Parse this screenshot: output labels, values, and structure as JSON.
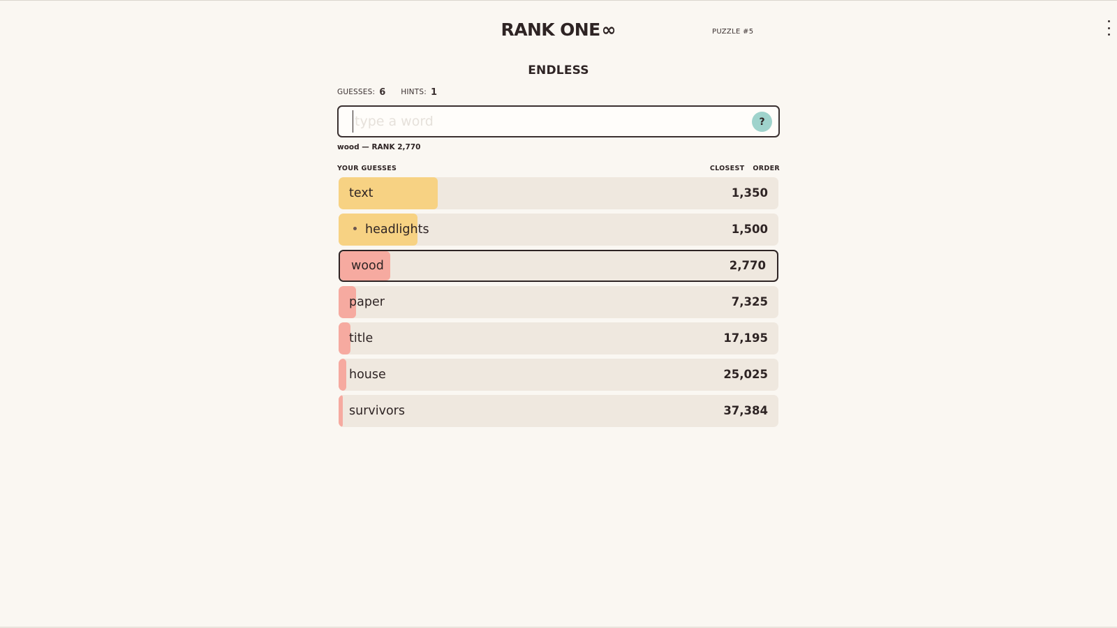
{
  "header": {
    "logo_text": "RANK ONE",
    "logo_symbol": "∞",
    "puzzle_label": "PUZZLE #5"
  },
  "mode": {
    "title": "ENDLESS"
  },
  "stats": {
    "guesses_label": "GUESSES:",
    "guesses_value": "6",
    "hints_label": "HINTS:",
    "hints_value": "1"
  },
  "input": {
    "placeholder": "type a word",
    "value": "",
    "help_label": "?"
  },
  "last_guess": {
    "text": "wood — RANK 2,770"
  },
  "list_header": {
    "title": "YOUR GUESSES",
    "sort_closest": "CLOSEST",
    "sort_order": "ORDER"
  },
  "colors": {
    "close": "#f7d283",
    "far": "#f6aaa0",
    "row_bg": "#efe8df",
    "accent_help": "#9fd3cc"
  },
  "guesses": [
    {
      "word": "text",
      "rank": "1,350",
      "fill": 0.225,
      "tier": "close",
      "hint": false,
      "selected": false
    },
    {
      "word": "headlights",
      "rank": "1,500",
      "fill": 0.18,
      "tier": "close",
      "hint": true,
      "selected": false
    },
    {
      "word": "wood",
      "rank": "2,770",
      "fill": 0.115,
      "tier": "far",
      "hint": false,
      "selected": true
    },
    {
      "word": "paper",
      "rank": "7,325",
      "fill": 0.04,
      "tier": "far",
      "hint": false,
      "selected": false
    },
    {
      "word": "title",
      "rank": "17,195",
      "fill": 0.027,
      "tier": "far",
      "hint": false,
      "selected": false
    },
    {
      "word": "house",
      "rank": "25,025",
      "fill": 0.018,
      "tier": "far",
      "hint": false,
      "selected": false
    },
    {
      "word": "survivors",
      "rank": "37,384",
      "fill": 0.01,
      "tier": "far",
      "hint": false,
      "selected": false
    }
  ]
}
